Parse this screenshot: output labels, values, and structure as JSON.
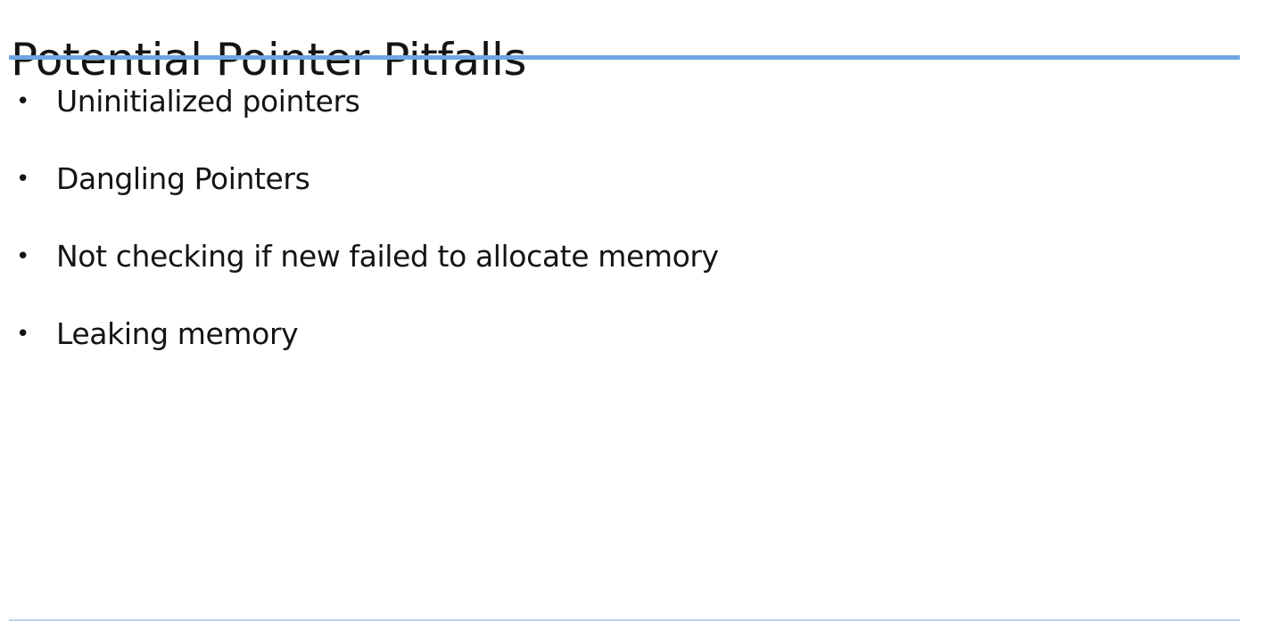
{
  "slide": {
    "title": "Potential Pointer Pitfalls",
    "accent_color": "#6fa6e3",
    "bullet_glyph": "•",
    "bullets": [
      "Uninitialized pointers",
      "Dangling Pointers",
      "Not checking if new failed to allocate memory",
      "Leaking memory"
    ]
  }
}
